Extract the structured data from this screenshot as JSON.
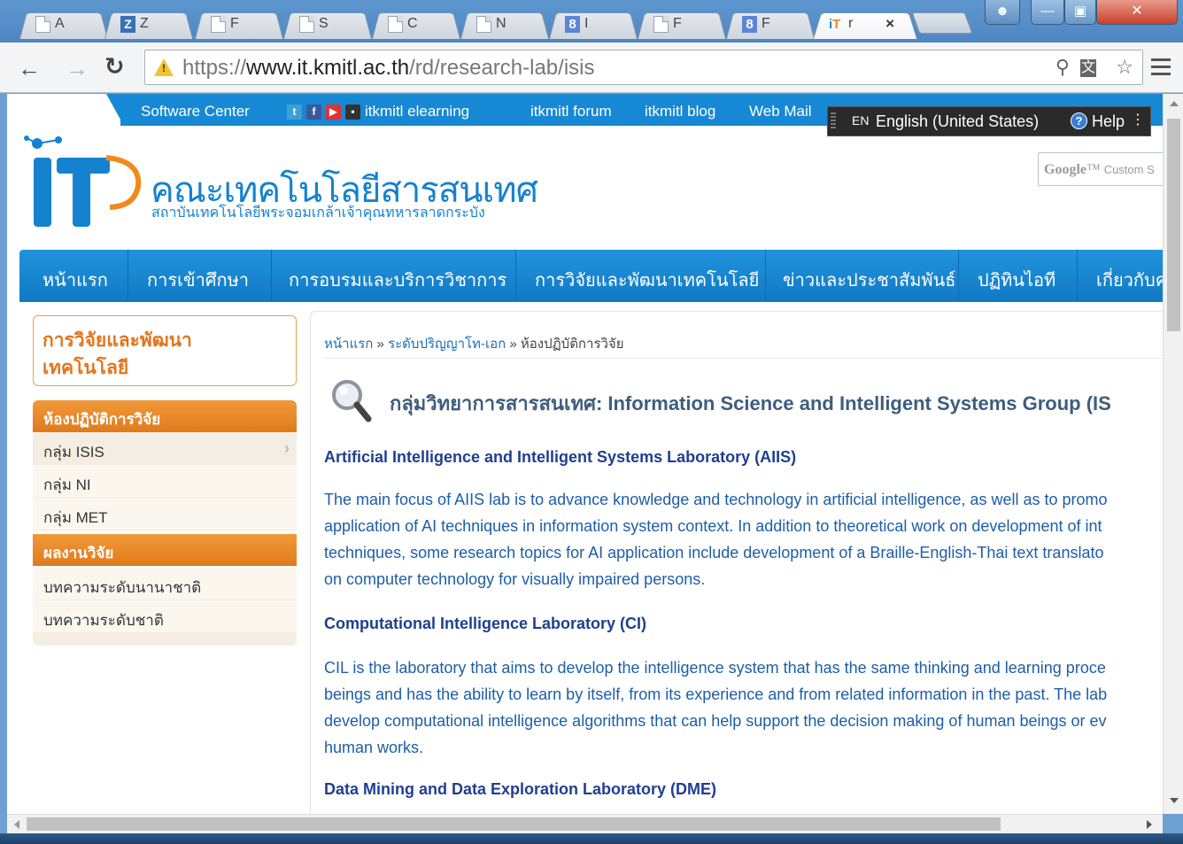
{
  "browser": {
    "tabs": [
      {
        "label": "A",
        "icon": "doc-icon"
      },
      {
        "label": "Z",
        "icon": "zotero-icon"
      },
      {
        "label": "F",
        "icon": "doc-icon"
      },
      {
        "label": "S",
        "icon": "doc-icon"
      },
      {
        "label": "C",
        "icon": "doc-icon"
      },
      {
        "label": "N",
        "icon": "doc-icon"
      },
      {
        "label": "I",
        "icon": "google-plus-icon"
      },
      {
        "label": "F",
        "icon": "doc-icon"
      },
      {
        "label": "F",
        "icon": "google-plus-icon"
      },
      {
        "label": "r",
        "icon": "itkmitl-icon",
        "active": true
      }
    ],
    "close_tab": "×",
    "url_scheme": "https://",
    "url_host": "www.it.kmitl.ac.th",
    "url_path": "/rd/research-lab/isis"
  },
  "site": {
    "toplinks": {
      "software_center": "Software Center",
      "elearning": "itkmitl elearning",
      "forum": "itkmitl forum",
      "blog": "itkmitl blog",
      "webmail": "Web Mail"
    },
    "lang_bar": {
      "code": "EN",
      "language": "English (United States)",
      "help": "Help"
    },
    "faculty_th": "คณะเทคโนโลยีสารสนเทศ",
    "institute_th": "สถาบันเทคโนโลยีพระจอมเกล้าเจ้าคุณทหารลาดกระบัง",
    "search_brand": "Google",
    "search_suffix": "Custom S",
    "nav": [
      "หน้าแรก",
      "การเข้าศึกษา",
      "การอบรมและบริการวิชาการ",
      "การวิจัยและพัฒนาเทคโนโลยี",
      "ข่าวและประชาสัมพันธ์",
      "ปฏิทินไอที",
      "เกี่ยวกับค"
    ]
  },
  "sidebar": {
    "title_line1": "การวิจัยและพัฒนา",
    "title_line2": "เทคโนโลยี",
    "sections": [
      {
        "heading": "ห้องปฏิบัติการวิจัย",
        "items": [
          "กลุ่ม ISIS",
          "กลุ่ม NI",
          "กลุ่ม MET"
        ]
      },
      {
        "heading": "ผลงานวิจัย",
        "items": [
          "บทความระดับนานาชาติ",
          "บทความระดับชาติ"
        ]
      }
    ],
    "chevron": "›"
  },
  "content": {
    "breadcrumb": {
      "home": "หน้าแรก",
      "sep": " » ",
      "level": "ระดับปริญญาโท-เอก",
      "current": "ห้องปฏิบัติการวิจัย"
    },
    "title": "กลุ่มวิทยาการสารสนเทศ: Information Science and Intelligent Systems Group (IS",
    "labs": [
      {
        "heading": "Artificial Intelligence and Intelligent Systems Laboratory  (AIIS)",
        "lines": [
          "The main focus of AIIS lab is to advance knowledge and technology in artificial intelligence, as well as to promo",
          "application of AI techniques in information system context. In addition to theoretical work on development of int",
          "techniques, some research topics for AI application include development of a Braille-English-Thai text translato",
          "on computer technology for visually impaired persons."
        ]
      },
      {
        "heading": "Computational Intelligence Laboratory (CI)",
        "lines": [
          "CIL is the laboratory that aims to develop the intelligence system that has the same thinking and learning proce",
          "beings and has the ability to learn by itself, from its experience and from related information in the past. The lab",
          "develop computational intelligence algorithms that can help support the decision making of human beings or ev",
          "human works."
        ]
      },
      {
        "heading": "Data Mining and Data Exploration Laboratory (DME)",
        "lines": []
      }
    ]
  },
  "colors": {
    "brand_blue": "#1788d4",
    "accent_orange": "#e4751b",
    "link_blue": "#1d5ea8"
  }
}
